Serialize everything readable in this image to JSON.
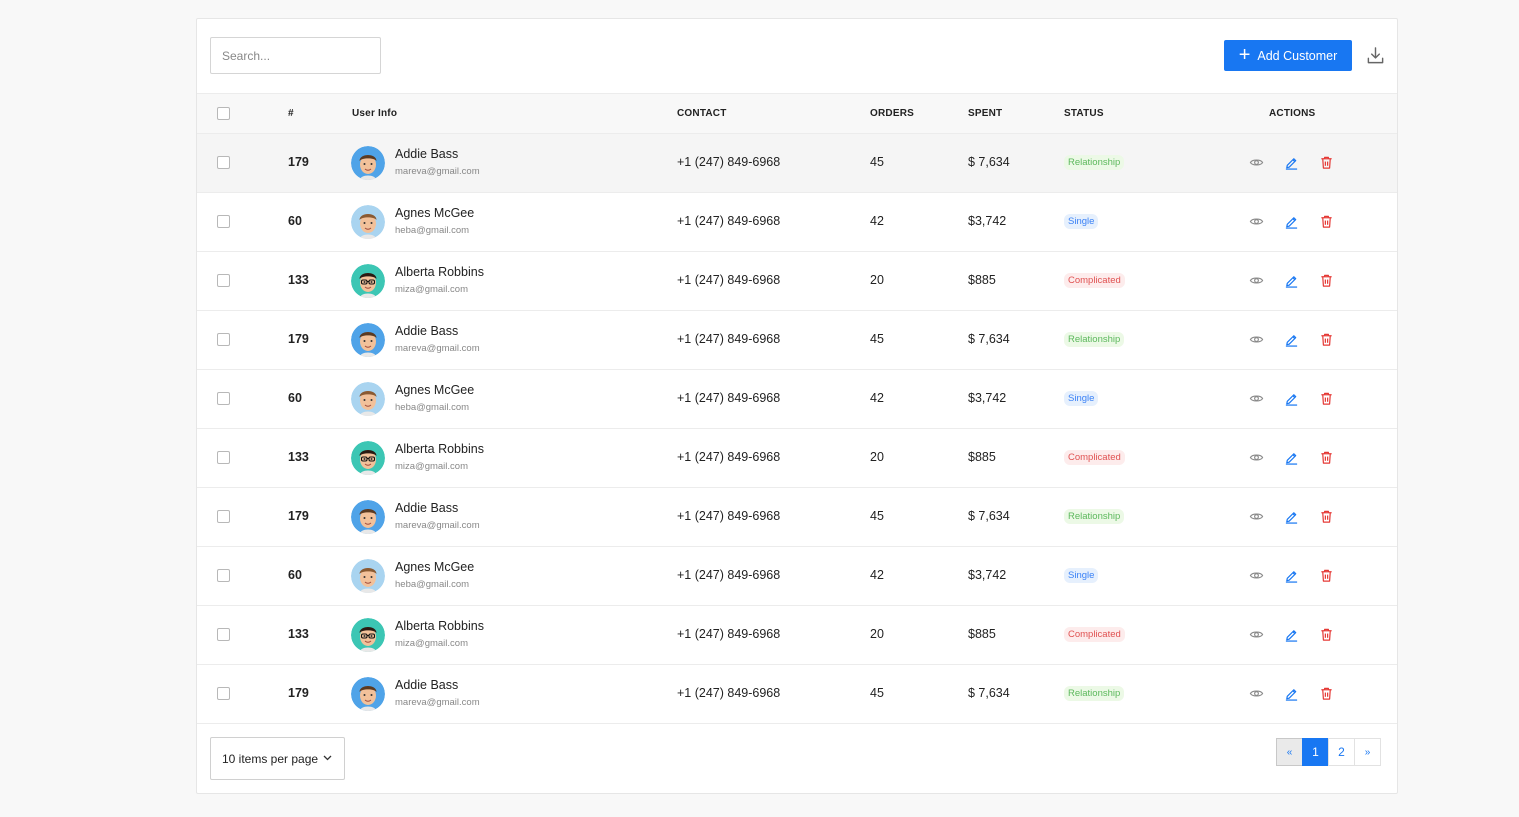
{
  "search": {
    "placeholder": "Search..."
  },
  "toolbar": {
    "add_label": "Add Customer"
  },
  "columns": {
    "number": "#",
    "user_info": "User Info",
    "contact": "CONTACT",
    "orders": "ORDERS",
    "spent": "SPENT",
    "status": "STATUS",
    "actions": "ACTIONS"
  },
  "rows": [
    {
      "id": "179",
      "name": "Addie Bass",
      "email": "mareva@gmail.com",
      "contact": "+1 (247) 849-6968",
      "orders": "45",
      "spent": "$ 7,634",
      "status": "Relationship",
      "avatar": "avatar-a"
    },
    {
      "id": "60",
      "name": "Agnes McGee",
      "email": "heba@gmail.com",
      "contact": "+1 (247) 849-6968",
      "orders": "42",
      "spent": "$3,742",
      "status": "Single",
      "avatar": "avatar-b"
    },
    {
      "id": "133",
      "name": "Alberta Robbins",
      "email": "miza@gmail.com",
      "contact": "+1 (247) 849-6968",
      "orders": "20",
      "spent": "$885",
      "status": "Complicated",
      "avatar": "avatar-c"
    },
    {
      "id": "179",
      "name": "Addie Bass",
      "email": "mareva@gmail.com",
      "contact": "+1 (247) 849-6968",
      "orders": "45",
      "spent": "$ 7,634",
      "status": "Relationship",
      "avatar": "avatar-a"
    },
    {
      "id": "60",
      "name": "Agnes McGee",
      "email": "heba@gmail.com",
      "contact": "+1 (247) 849-6968",
      "orders": "42",
      "spent": "$3,742",
      "status": "Single",
      "avatar": "avatar-b"
    },
    {
      "id": "133",
      "name": "Alberta Robbins",
      "email": "miza@gmail.com",
      "contact": "+1 (247) 849-6968",
      "orders": "20",
      "spent": "$885",
      "status": "Complicated",
      "avatar": "avatar-c"
    },
    {
      "id": "179",
      "name": "Addie Bass",
      "email": "mareva@gmail.com",
      "contact": "+1 (247) 849-6968",
      "orders": "45",
      "spent": "$ 7,634",
      "status": "Relationship",
      "avatar": "avatar-a"
    },
    {
      "id": "60",
      "name": "Agnes McGee",
      "email": "heba@gmail.com",
      "contact": "+1 (247) 849-6968",
      "orders": "42",
      "spent": "$3,742",
      "status": "Single",
      "avatar": "avatar-b"
    },
    {
      "id": "133",
      "name": "Alberta Robbins",
      "email": "miza@gmail.com",
      "contact": "+1 (247) 849-6968",
      "orders": "20",
      "spent": "$885",
      "status": "Complicated",
      "avatar": "avatar-c"
    },
    {
      "id": "179",
      "name": "Addie Bass",
      "email": "mareva@gmail.com",
      "contact": "+1 (247) 849-6968",
      "orders": "45",
      "spent": "$ 7,634",
      "status": "Relationship",
      "avatar": "avatar-a"
    }
  ],
  "status_styles": {
    "Relationship": {
      "bg": "#ecf9e6",
      "fg": "#5cb85c"
    },
    "Single": {
      "bg": "#e6f0fd",
      "fg": "#3b82f6"
    },
    "Complicated": {
      "bg": "#fdecec",
      "fg": "#e05252"
    }
  },
  "avatars": {
    "avatar-a": {
      "bg": "#4fa3e8"
    },
    "avatar-b": {
      "bg": "#a9d4f0"
    },
    "avatar-c": {
      "bg": "#3cc6b4"
    }
  },
  "icons": {
    "view": "eye-icon",
    "edit": "pencil-icon",
    "delete": "trash-icon",
    "download": "download-icon",
    "add": "plus-icon"
  },
  "colors": {
    "accent": "#1877f2",
    "danger": "#e53935",
    "muted": "#8a8a8a"
  },
  "pagination": {
    "per_page_label": "10 items per page",
    "prev": "«",
    "pages": [
      "1",
      "2"
    ],
    "current": "1",
    "next": "»"
  }
}
